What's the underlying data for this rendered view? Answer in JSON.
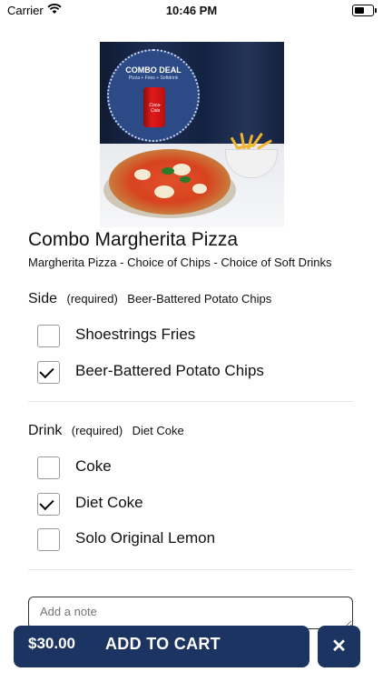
{
  "status_bar": {
    "carrier": "Carrier",
    "time": "10:46 PM",
    "battery_level": 0.6
  },
  "product": {
    "image_deal_title": "COMBO DEAL",
    "image_deal_subtitle": "Pizza + Fries + Softdrink",
    "image_can_label": "Coca-Cola",
    "name": "Combo Margherita Pizza",
    "description": "Margherita Pizza - Choice of Chips - Choice of Soft Drinks"
  },
  "groups": [
    {
      "name": "Side",
      "required": "(required)",
      "selected": "Beer-Battered Potato Chips",
      "options": [
        {
          "label": "Shoestrings Fries",
          "checked": false
        },
        {
          "label": "Beer-Battered Potato Chips",
          "checked": true
        }
      ]
    },
    {
      "name": "Drink",
      "required": "(required)",
      "selected": "Diet Coke",
      "options": [
        {
          "label": "Coke",
          "checked": false
        },
        {
          "label": "Diet Coke",
          "checked": true
        },
        {
          "label": "Solo Original Lemon",
          "checked": false
        }
      ]
    }
  ],
  "note": {
    "placeholder": "Add a note",
    "value": ""
  },
  "footer": {
    "price": "$30.00",
    "add_label": "ADD TO CART",
    "close_label": "✕"
  },
  "colors": {
    "accent": "#1c3461"
  }
}
